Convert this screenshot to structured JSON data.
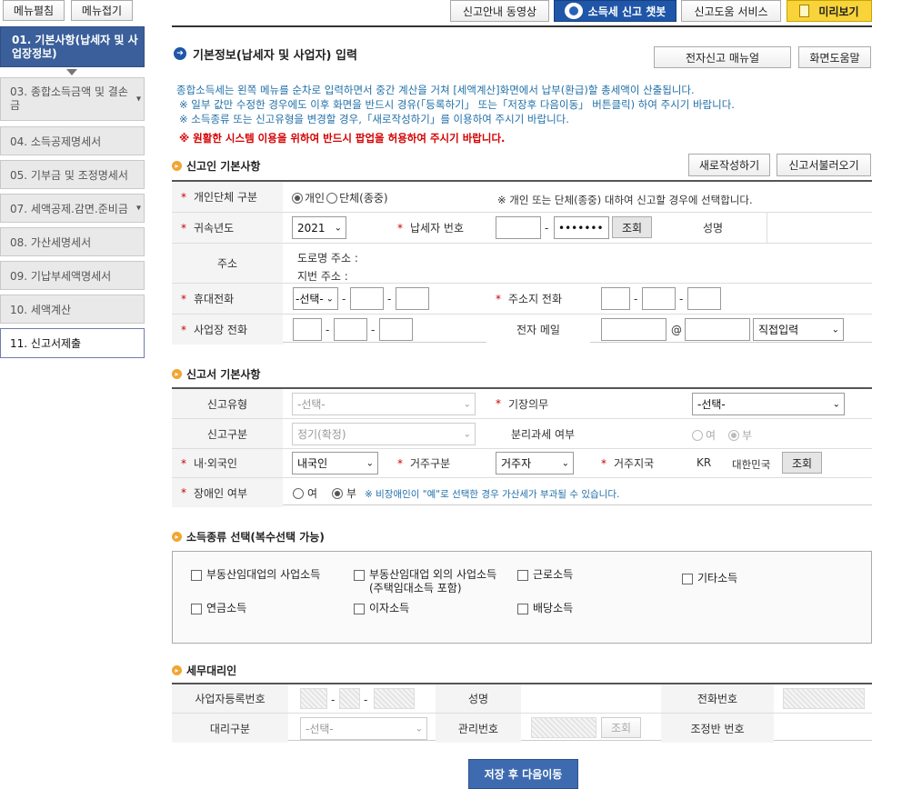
{
  "top": {
    "menu_open": "메뉴펼침",
    "menu_close": "메뉴접기",
    "video": "신고안내 동영상",
    "chatbot": "소득세 신고 챗봇",
    "help_service": "신고도움 서비스",
    "preview": "미리보기"
  },
  "sidebar": {
    "items": [
      {
        "label": "01. 기본사항(납세자 및 사업장정보)"
      },
      {
        "label": "03. 종합소득금액 및 결손금"
      },
      {
        "label": "04. 소득공제명세서"
      },
      {
        "label": "05. 기부금 및 조정명세서"
      },
      {
        "label": "07. 세액공제.감면.준비금"
      },
      {
        "label": "08. 가산세명세서"
      },
      {
        "label": "09. 기납부세액명세서"
      },
      {
        "label": "10. 세액계산"
      },
      {
        "label": "11. 신고서제출"
      }
    ]
  },
  "page": {
    "title": "기본정보(납세자 및 사업자) 입력",
    "manual": "전자신고 매뉴얼",
    "screen_help": "화면도움말",
    "info1": "종합소득세는 왼쪽 메뉴를 순차로 입력하면서 중간 계산을 거쳐 [세액계산]화면에서 납부(환급)할 총세액이 산출됩니다.",
    "info2": "※ 일부 값만 수정한 경우에도 이후 화면을 반드시 경유(「등록하기」 또는「저장후 다음이동」 버튼클릭) 하여 주시기 바랍니다.",
    "info3": "※ 소득종류 또는 신고유형을 변경할 경우,「새로작성하기」를 이용하여 주시기 바랍니다.",
    "warn": "※ 원활한 시스템 이용을 위하여 반드시 팝업을 허용하여 주시기 바랍니다."
  },
  "s1": {
    "title": "신고인 기본사항",
    "new": "새로작성하기",
    "load": "신고서불러오기",
    "star": "*",
    "l_type": "개인단체 구분",
    "opt_person": "개인",
    "opt_group": "단체(종중)",
    "type_note": "※ 개인 또는 단체(종중) 대하여 신고할 경우에 선택합니다.",
    "l_year": "귀속년도",
    "year": "2021",
    "l_taxid": "납세자 번호",
    "taxid_masked": "•••••••",
    "lookup": "조회",
    "l_name": "성명",
    "l_addr": "주소",
    "road": "도로명 주소 :",
    "lot": "지번 주소 :",
    "l_mobile": "휴대전화",
    "mobile_sel": "-선택-",
    "l_homephone": "주소지 전화",
    "l_bizphone": "사업장 전화",
    "l_email": "전자 메일",
    "at": "@",
    "email_domain": "직접입력"
  },
  "s2": {
    "title": "신고서 기본사항",
    "l_rtype": "신고유형",
    "rtype": "-선택-",
    "l_book": "기장의무",
    "book": "-선택-",
    "l_rdiv": "신고구분",
    "rdiv": "정기(확정)",
    "l_sep": "분리과세 여부",
    "yes": "여",
    "no": "부",
    "l_resident": "내·외국인",
    "resident": "내국인",
    "l_res_div": "거주구분",
    "res_div": "거주자",
    "l_country": "거주지국",
    "country_code": "KR",
    "country_name": "대한민국",
    "lookup": "조회",
    "l_disabled": "장애인 여부",
    "dis_note": "※ 비장애인이 \"예\"로 선택한 경우 가산세가 부과될 수 있습니다."
  },
  "s3": {
    "title": "소득종류 선택(복수선택 가능)",
    "c1": "부동산임대업의 사업소득",
    "c2a": "부동산임대업 외의 사업소득",
    "c2b": "(주택임대소득 포함)",
    "c3": "근로소득",
    "c4": "기타소득",
    "c5": "연금소득",
    "c6": "이자소득",
    "c7": "배당소득"
  },
  "s4": {
    "title": "세무대리인",
    "l_bizno": "사업자등록번호",
    "l_name": "성명",
    "l_phone": "전화번호",
    "l_agent": "대리구분",
    "agent": "-선택-",
    "l_mgmt": "관리번호",
    "lookup": "조회",
    "l_adj": "조정반 번호"
  },
  "footer": {
    "save": "저장 후 다음이동"
  }
}
